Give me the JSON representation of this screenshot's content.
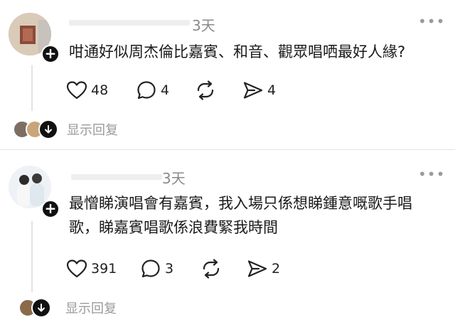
{
  "comments": [
    {
      "time": "3天",
      "more": "•••",
      "text": "咁通好似周杰倫比嘉賓、和音、觀眾唱哂最好人緣?",
      "likes": "48",
      "replies_count": "4",
      "shares": "4",
      "show_replies": "显示回复",
      "colors": {
        "avatar": "#c9b8a4"
      }
    },
    {
      "time": "3天",
      "more": "•••",
      "text_line1": "最憎睇演唱會有嘉賓，我入場只係想睇鍾意嘅歌手唱",
      "text_line2": "歌，睇嘉賓唱歌係浪費緊我時間",
      "likes": "391",
      "replies_count": "3",
      "shares": "2",
      "show_replies": "显示回复",
      "colors": {
        "avatar": "#e8eef4"
      }
    }
  ]
}
